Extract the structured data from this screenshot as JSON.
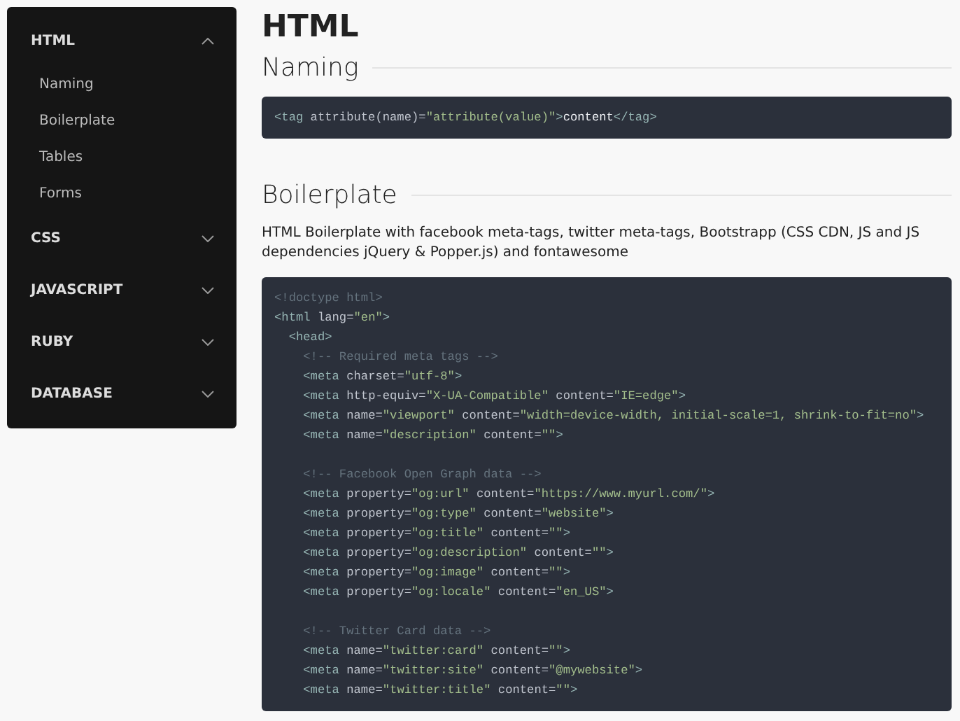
{
  "sidebar": {
    "sections": [
      {
        "label": "HTML",
        "expanded": true,
        "items": [
          "Naming",
          "Boilerplate",
          "Tables",
          "Forms"
        ]
      },
      {
        "label": "CSS",
        "expanded": false
      },
      {
        "label": "JAVASCRIPT",
        "expanded": false
      },
      {
        "label": "RUBY",
        "expanded": false
      },
      {
        "label": "DATABASE",
        "expanded": false
      }
    ]
  },
  "page_title": "HTML",
  "sections": [
    {
      "heading": "Naming",
      "code_blocks": [
        {
          "lines": [
            {
              "kind": "code",
              "text": "<tag attribute(name)=\"attribute(value)\">content</tag>"
            }
          ]
        }
      ]
    },
    {
      "heading": "Boilerplate",
      "description": "HTML Boilerplate with facebook meta-tags, twitter meta-tags, Bootstrapp (CSS CDN, JS and JS dependencies jQuery & Popper.js) and fontawesome",
      "code_blocks": [
        {
          "lines": [
            {
              "kind": "comment",
              "text": "<!doctype html>"
            },
            {
              "kind": "code",
              "text": "<html lang=\"en\">"
            },
            {
              "kind": "code",
              "text": "  <head>"
            },
            {
              "kind": "comment",
              "text": "    <!-- Required meta tags -->"
            },
            {
              "kind": "code",
              "text": "    <meta charset=\"utf-8\">"
            },
            {
              "kind": "code",
              "text": "    <meta http-equiv=\"X-UA-Compatible\" content=\"IE=edge\">"
            },
            {
              "kind": "code",
              "text": "    <meta name=\"viewport\" content=\"width=device-width, initial-scale=1, shrink-to-fit=no\">"
            },
            {
              "kind": "code",
              "text": "    <meta name=\"description\" content=\"\">"
            }
          ]
        },
        {
          "lines": [
            {
              "kind": "comment",
              "text": "    <!-- Facebook Open Graph data -->"
            },
            {
              "kind": "code",
              "text": "    <meta property=\"og:url\" content=\"https://www.myurl.com/\">"
            },
            {
              "kind": "code",
              "text": "    <meta property=\"og:type\" content=\"website\">"
            },
            {
              "kind": "code",
              "text": "    <meta property=\"og:title\" content=\"\">"
            },
            {
              "kind": "code",
              "text": "    <meta property=\"og:description\" content=\"\">"
            },
            {
              "kind": "code",
              "text": "    <meta property=\"og:image\" content=\"\">"
            },
            {
              "kind": "code",
              "text": "    <meta property=\"og:locale\" content=\"en_US\">"
            }
          ]
        },
        {
          "lines": [
            {
              "kind": "comment",
              "text": "    <!-- Twitter Card data -->"
            },
            {
              "kind": "code",
              "text": "    <meta name=\"twitter:card\" content=\"\">"
            },
            {
              "kind": "code",
              "text": "    <meta name=\"twitter:site\" content=\"@mywebsite\">"
            },
            {
              "kind": "code",
              "text": "    <meta name=\"twitter:title\" content=\"\">"
            }
          ]
        }
      ]
    }
  ]
}
